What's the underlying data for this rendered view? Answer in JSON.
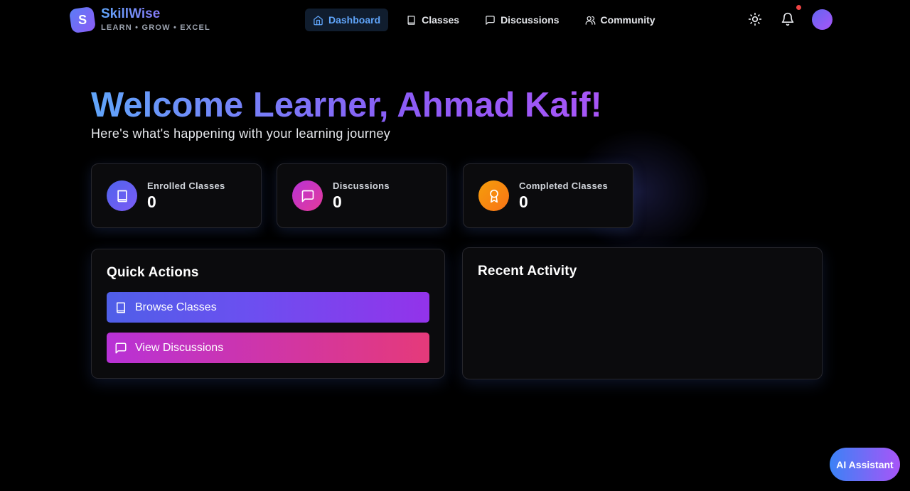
{
  "brand": {
    "name": "SkillWise",
    "tagline": "LEARN • GROW • EXCEL",
    "mark": "S"
  },
  "nav": {
    "items": [
      {
        "label": "Dashboard",
        "icon": "home-icon",
        "active": true
      },
      {
        "label": "Classes",
        "icon": "book-icon",
        "active": false
      },
      {
        "label": "Discussions",
        "icon": "message-icon",
        "active": false
      },
      {
        "label": "Community",
        "icon": "users-icon",
        "active": false
      }
    ]
  },
  "header_tools": {
    "theme_icon": "sun-icon",
    "notifications_icon": "bell-icon",
    "has_unread": true
  },
  "hero": {
    "welcome": "Welcome Learner, Ahmad Kaif!",
    "subtitle": "Here's what's happening with your learning journey"
  },
  "stats": [
    {
      "label": "Enrolled Classes",
      "value": "0",
      "icon": "book-icon",
      "color": "#6366f1"
    },
    {
      "label": "Discussions",
      "value": "0",
      "icon": "message-icon",
      "color": "#c026d3"
    },
    {
      "label": "Completed Classes",
      "value": "0",
      "icon": "award-icon",
      "color": "#f59e0b"
    }
  ],
  "quick_actions": {
    "title": "Quick Actions",
    "buttons": [
      {
        "label": "Browse Classes",
        "icon": "book-icon"
      },
      {
        "label": "View Discussions",
        "icon": "message-icon"
      }
    ]
  },
  "recent_activity": {
    "title": "Recent Activity"
  },
  "ai_assistant": {
    "label": "AI Assistant"
  },
  "colors": {
    "accent_blue": "#60a5fa",
    "accent_purple": "#a855f7",
    "browse_gradient": [
      "#4f63ec",
      "#9333ea"
    ],
    "discussions_gradient": [
      "#b832d6",
      "#e53a7a"
    ],
    "notification": "#ef4444"
  }
}
